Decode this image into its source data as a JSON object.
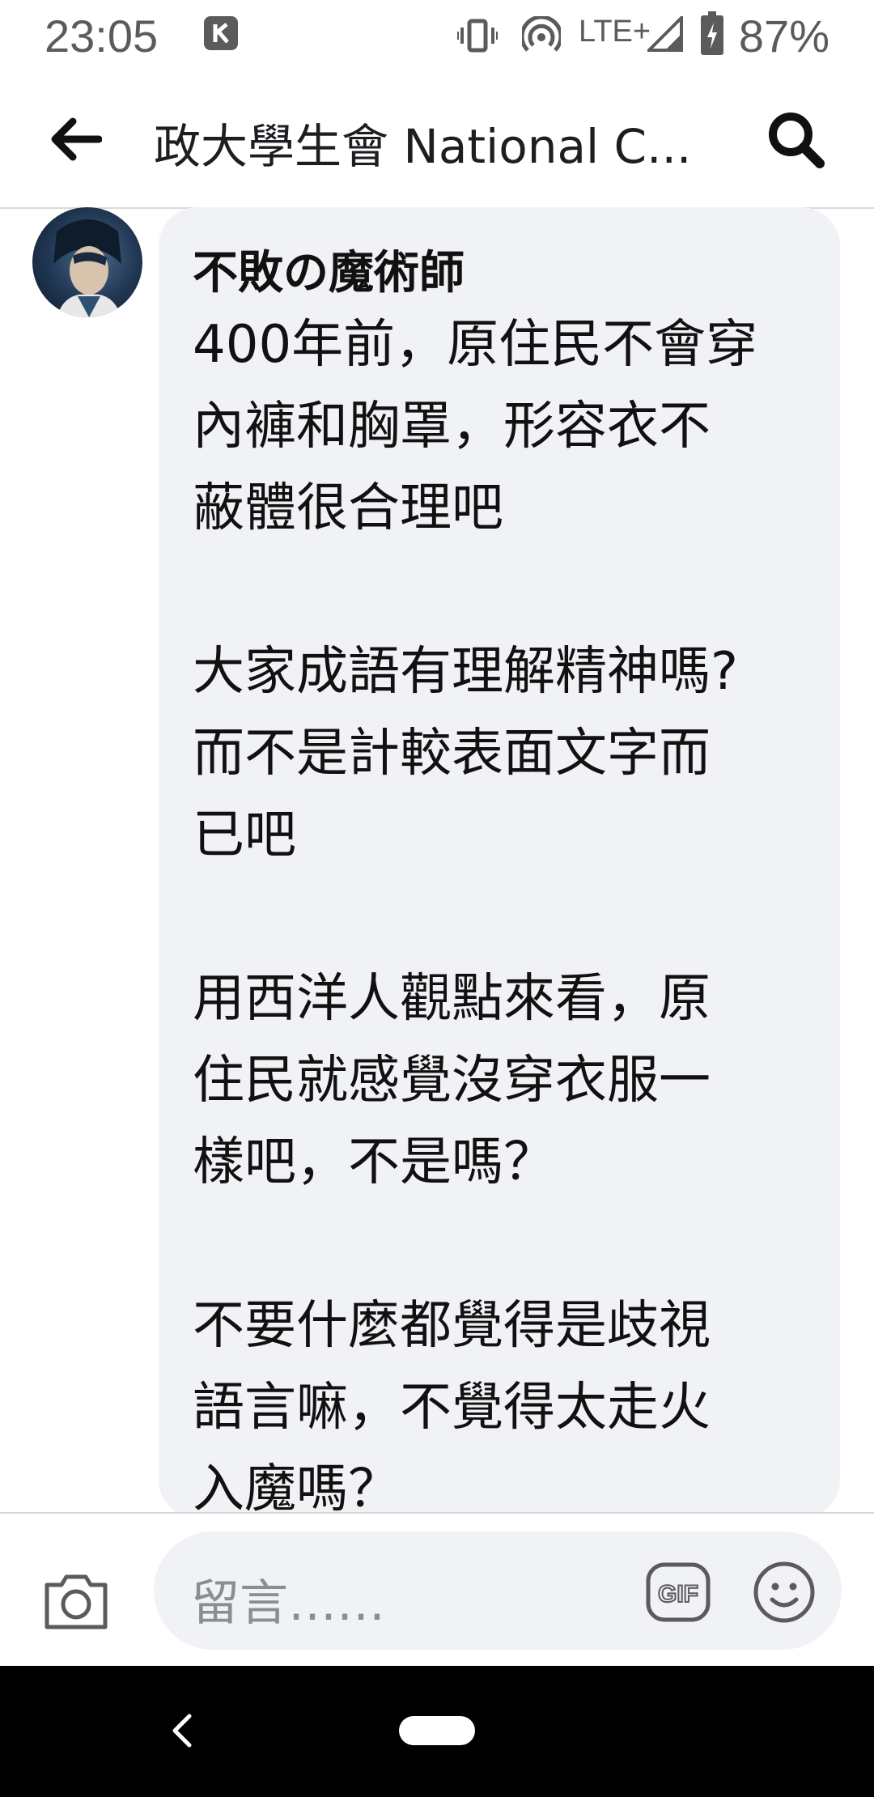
{
  "status_bar": {
    "time": "23:05",
    "app_icon": "k-app-icon",
    "network": "LTE+",
    "battery": "87%"
  },
  "app_bar": {
    "title": "政大學生會 National C..."
  },
  "comment": {
    "author": "不敗の魔術師",
    "text": "400年前，原住民不會穿\n內褲和胸罩，形容衣不\n蔽體很合理吧\n\n大家成語有理解精神嗎?\n而不是計較表面文字而\n已吧\n\n用西洋人觀點來看，原\n住民就感覺沒穿衣服一\n樣吧，不是嗎？\n\n不要什麼都覺得是歧視\n語言嘛，不覺得太走火\n入魔嗎？"
  },
  "composer": {
    "placeholder": "留言……",
    "gif_label": "GIF"
  },
  "colors": {
    "bubble_bg": "#f0f2f5",
    "nav_bg": "#000000",
    "status_text": "#5b5b5b"
  }
}
